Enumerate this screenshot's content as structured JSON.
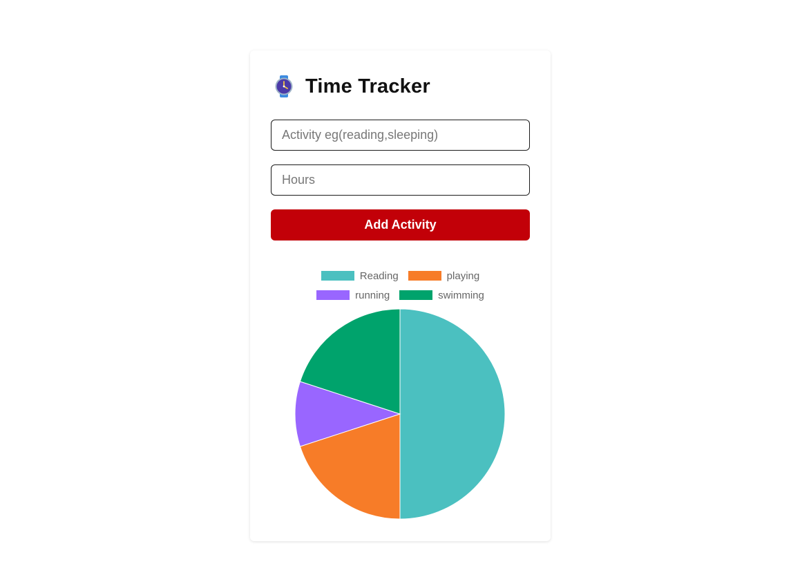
{
  "app": {
    "title": "Time Tracker",
    "icon": "wristwatch-icon"
  },
  "form": {
    "activity_placeholder": "Activity eg(reading,sleeping)",
    "activity_value": "",
    "hours_placeholder": "Hours",
    "hours_value": "",
    "add_label": "Add Activity",
    "add_color": "#c20008"
  },
  "chart_data": {
    "type": "pie",
    "categories": [
      "Reading",
      "playing",
      "running",
      "swimming"
    ],
    "values": [
      50,
      20,
      10,
      20
    ],
    "colors": [
      "#4bc0c0",
      "#f77c28",
      "#9966ff",
      "#00a36c"
    ],
    "legend": "top"
  }
}
